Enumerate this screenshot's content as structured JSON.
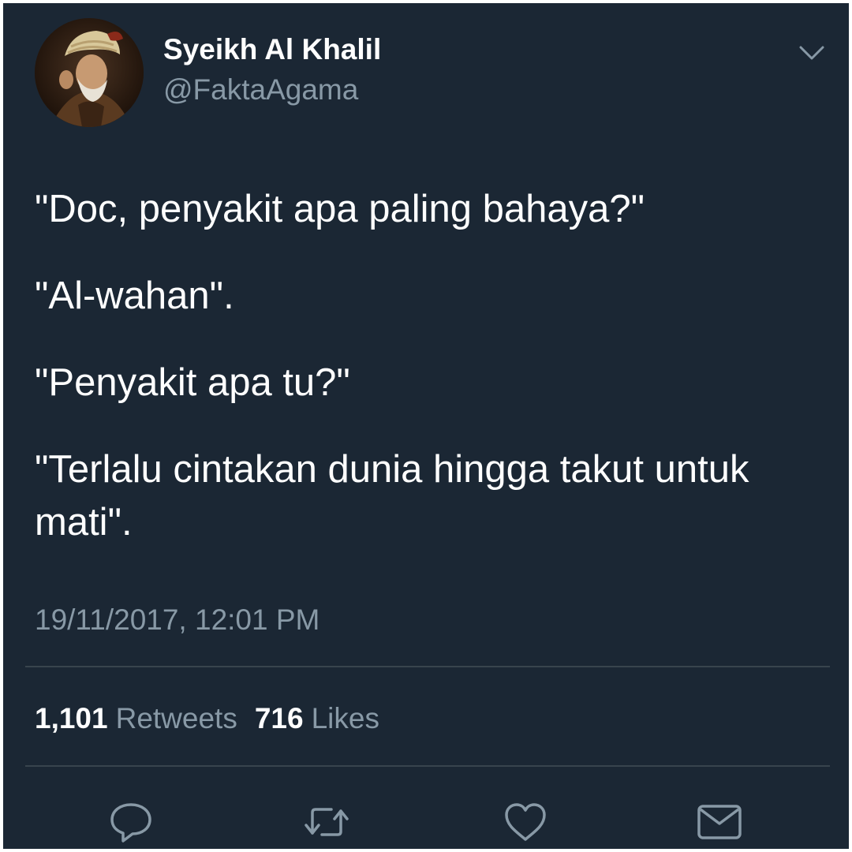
{
  "user": {
    "display_name": "Syeikh Al Khalil",
    "handle": "@FaktaAgama",
    "avatar_icon": "portrait-avatar"
  },
  "menu": {
    "caret_icon": "chevron-down-icon"
  },
  "tweet": {
    "paragraphs": [
      "\"Doc, penyakit apa paling bahaya?\"",
      "\"Al-wahan\".",
      "\"Penyakit apa tu?\"",
      "\"Terlalu cintakan dunia hingga takut untuk mati\"."
    ],
    "timestamp": "19/11/2017, 12:01 PM"
  },
  "stats": {
    "retweets_count": "1,101",
    "retweets_label": "Retweets",
    "likes_count": "716",
    "likes_label": "Likes"
  },
  "actions": [
    {
      "name": "reply",
      "icon": "reply-icon"
    },
    {
      "name": "retweet",
      "icon": "retweet-icon"
    },
    {
      "name": "like",
      "icon": "heart-icon"
    },
    {
      "name": "share",
      "icon": "envelope-icon"
    }
  ],
  "colors": {
    "background": "#1b2734",
    "primary_text": "#ffffff",
    "secondary_text": "#8899a6",
    "divider": "#38444d"
  }
}
